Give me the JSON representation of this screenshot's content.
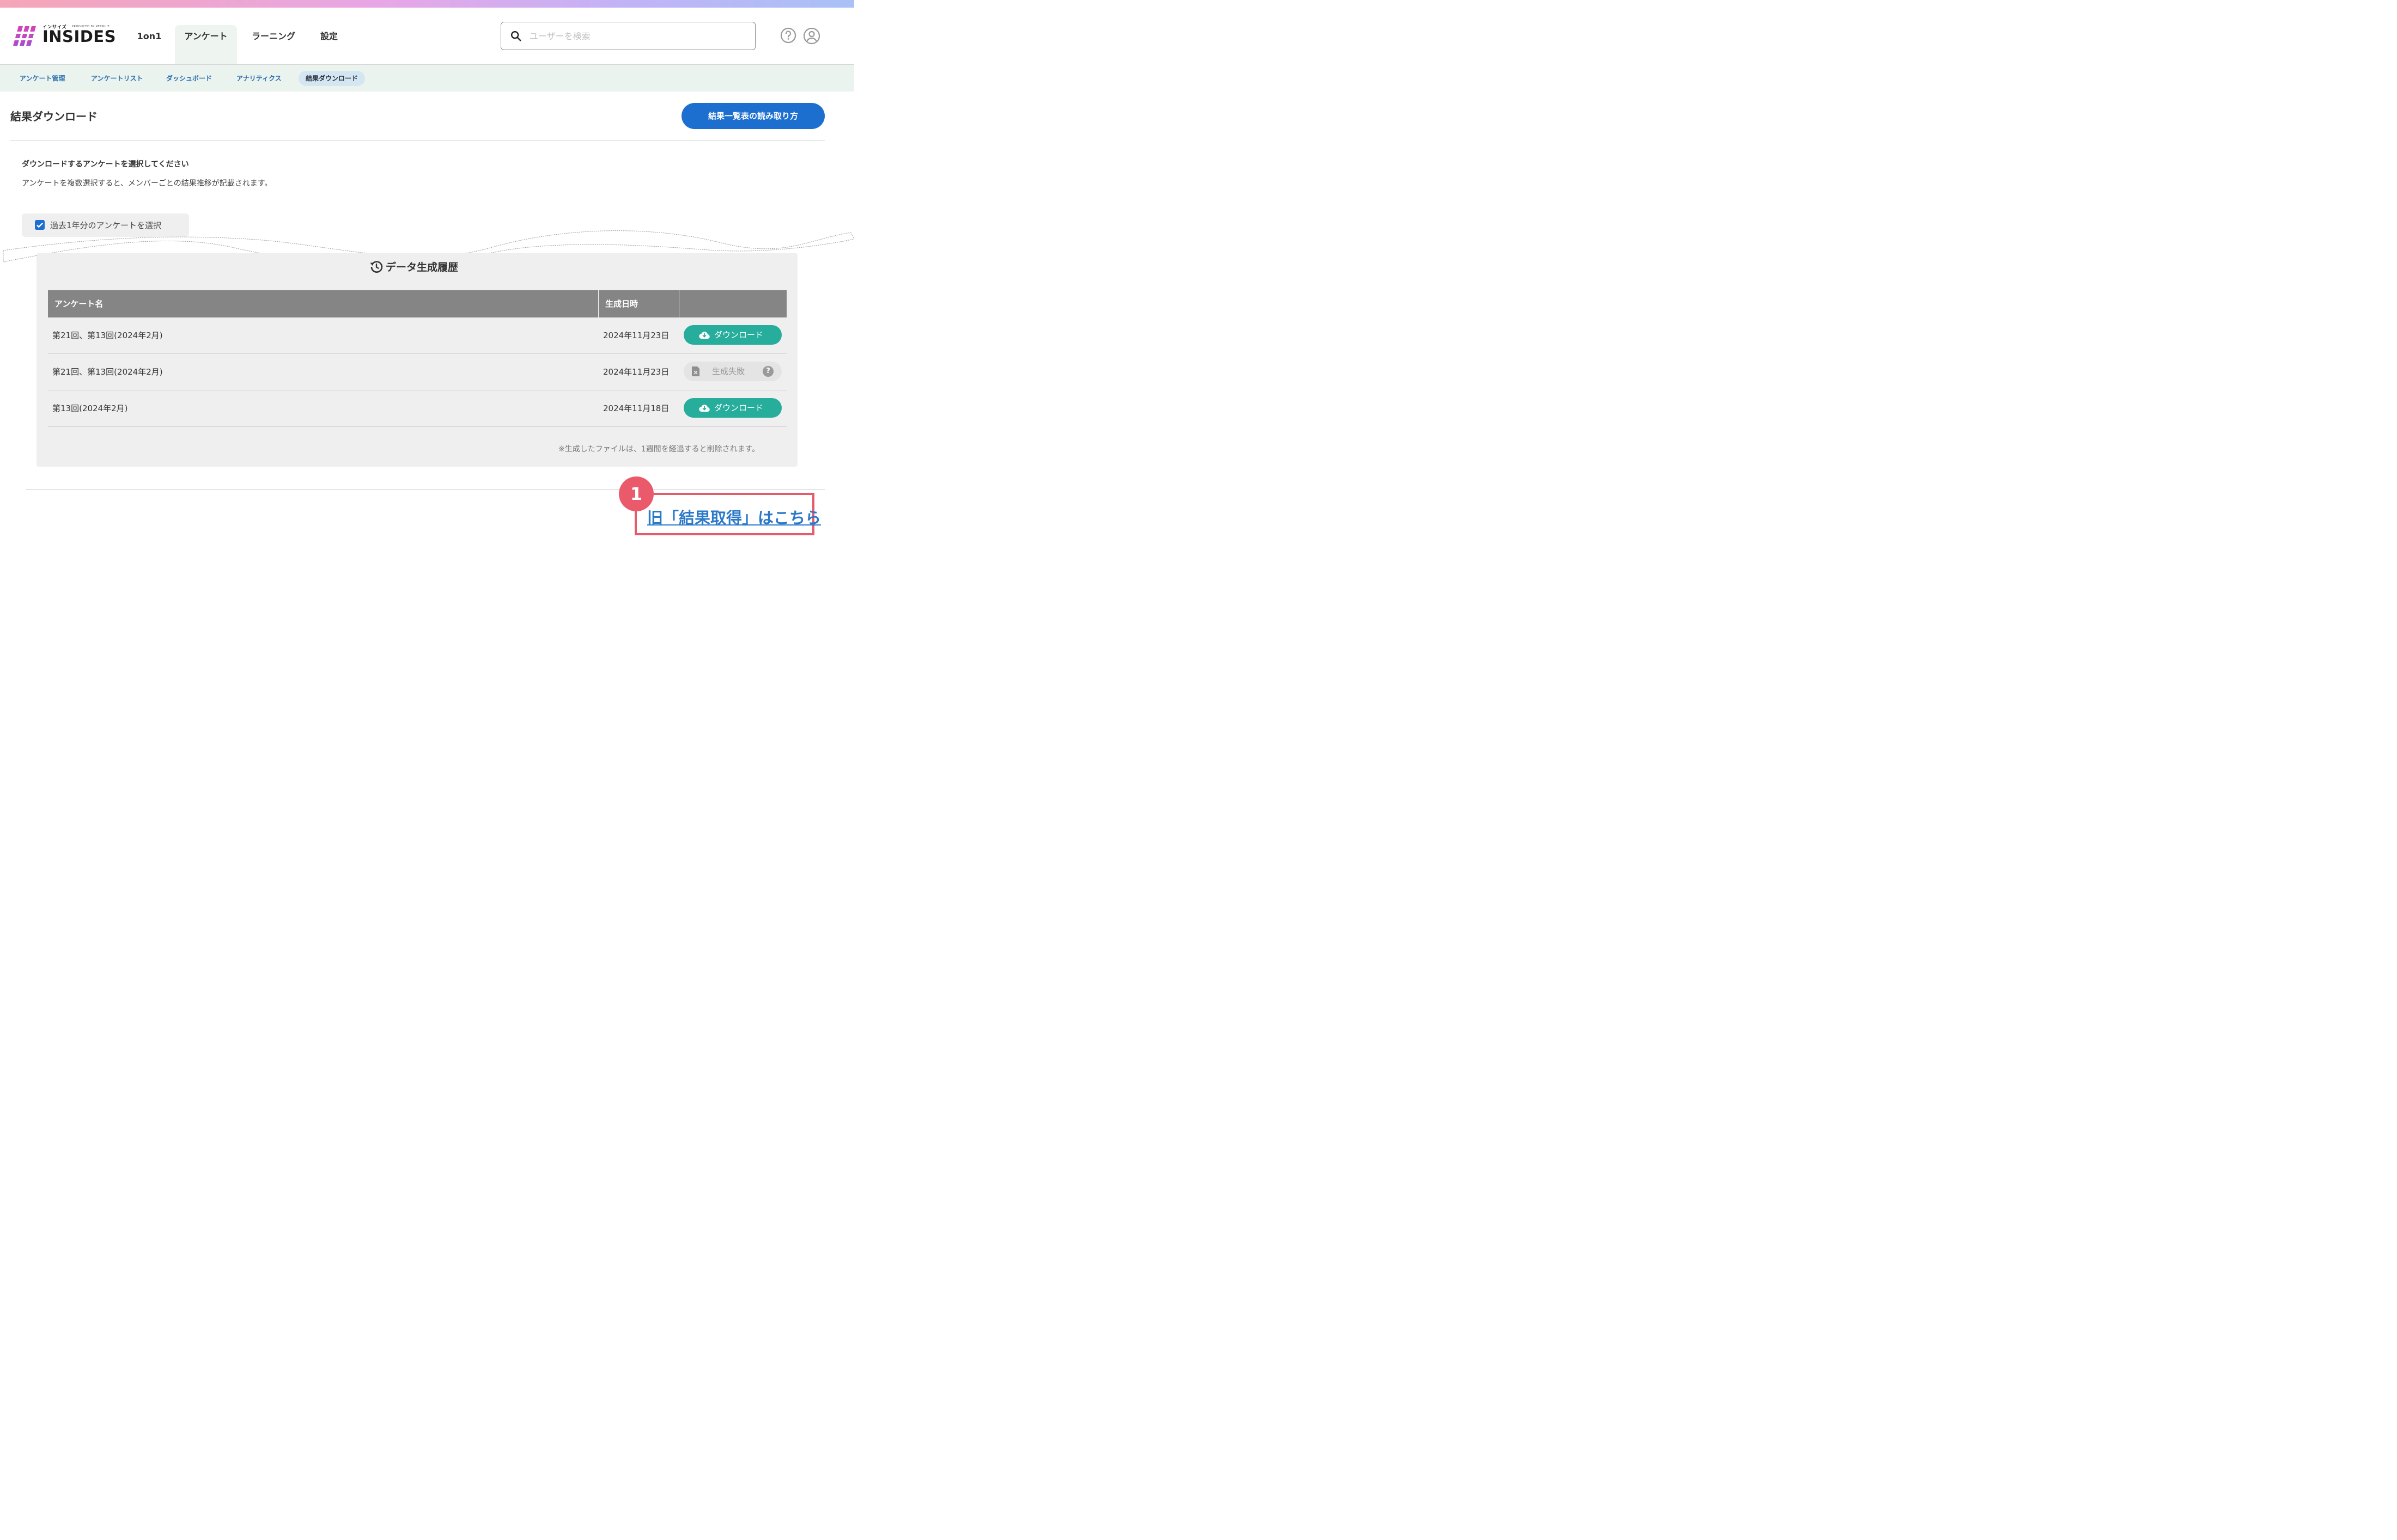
{
  "brand": {
    "logo_text": "INSIDES",
    "logo_kana": "インサイズ",
    "logo_producer": "PRODUCED BY RECRUIT",
    "brand_color": "#e4366a"
  },
  "nav": {
    "tabs": [
      {
        "label": "1on1",
        "active": false
      },
      {
        "label": "アンケート",
        "active": true
      },
      {
        "label": "ラーニング",
        "active": false
      },
      {
        "label": "設定",
        "active": false
      }
    ]
  },
  "search": {
    "placeholder": "ユーザーを検索",
    "value": ""
  },
  "header_icons": [
    "help-icon",
    "user-account-icon"
  ],
  "subnav": {
    "items": [
      {
        "label": "アンケート管理",
        "active": false
      },
      {
        "label": "アンケートリスト",
        "active": false
      },
      {
        "label": "ダッシュボード",
        "active": false
      },
      {
        "label": "アナリティクス",
        "active": false
      },
      {
        "label": "結果ダウンロード",
        "active": true
      }
    ]
  },
  "page": {
    "title": "結果ダウンロード",
    "guide_button": "結果一覧表の読み取り方",
    "instruction_heading": "ダウンロードするアンケートを選択してください",
    "instruction_note": "アンケートを複数選択すると、メンバーごとの結果推移が記載されます。",
    "checkbox_label": "過去1年分のアンケートを選択",
    "checkbox_checked": true
  },
  "history": {
    "title": "データ生成履歴",
    "columns": [
      "アンケート名",
      "生成日時",
      ""
    ],
    "rows": [
      {
        "name": "第21回、第13回(2024年2月)",
        "date": "2024年11月23日",
        "status": "download",
        "action_label": "ダウンロード"
      },
      {
        "name": "第21回、第13回(2024年2月)",
        "date": "2024年11月23日",
        "status": "failed",
        "action_label": "生成失敗"
      },
      {
        "name": "第13回(2024年2月)",
        "date": "2024年11月18日",
        "status": "download",
        "action_label": "ダウンロード"
      }
    ],
    "footnote": "※生成したファイルは、1週間を経過すると削除されます。",
    "colors": {
      "download": "#26ad9b",
      "failed": "#e4e4e4"
    }
  },
  "annotation": {
    "badge_number": "1",
    "link_text": "旧「結果取得」はこちら",
    "highlight_color": "#e45b6b"
  }
}
